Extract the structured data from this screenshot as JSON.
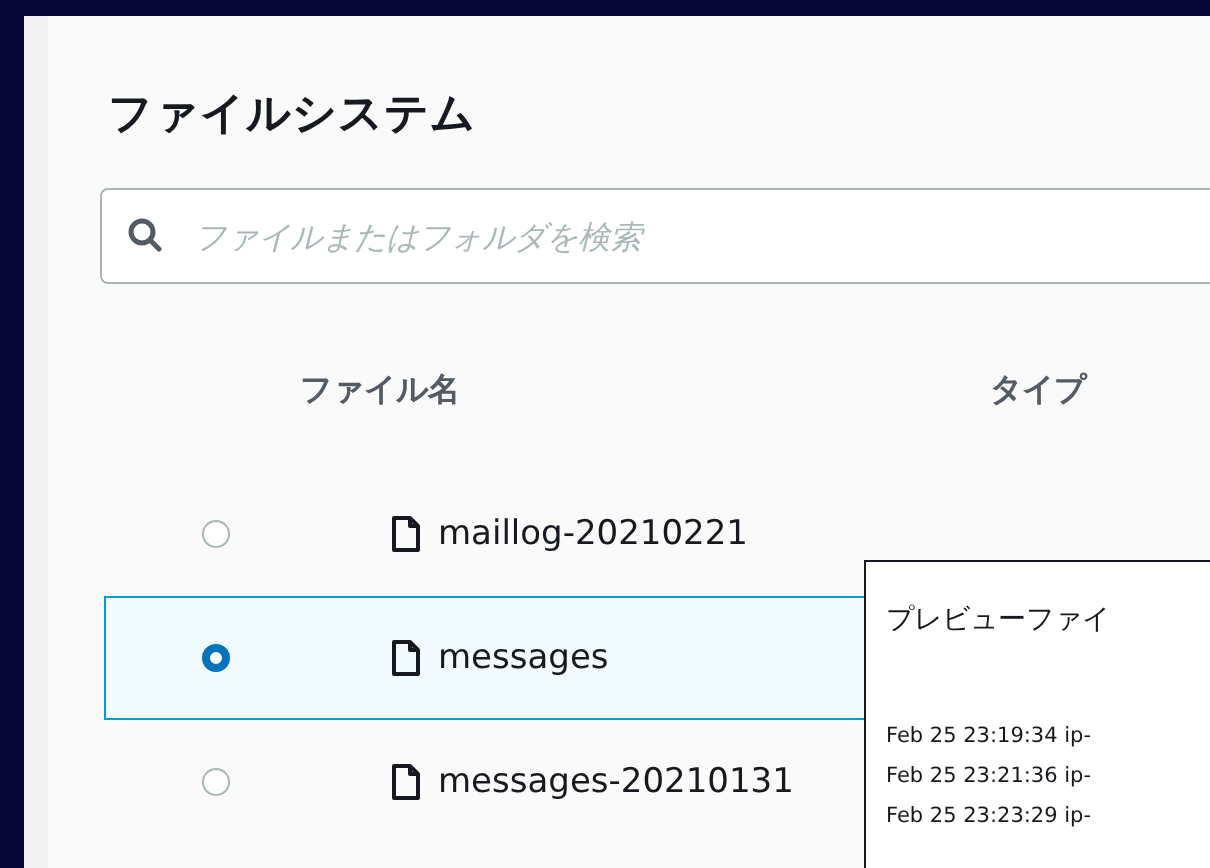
{
  "title": "ファイルシステム",
  "search": {
    "placeholder": "ファイルまたはフォルダを検索"
  },
  "table": {
    "columns": [
      "ファイル名",
      "タイプ"
    ],
    "rows": [
      {
        "name": "maillog-20210221",
        "selected": false
      },
      {
        "name": "messages",
        "selected": true
      },
      {
        "name": "messages-20210131",
        "selected": false
      }
    ]
  },
  "preview": {
    "title": "プレビューファイ",
    "lines": [
      "Feb 25 23:19:34 ip-",
      "Feb 25 23:21:36 ip-",
      "Feb 25 23:23:29 ip-"
    ]
  }
}
